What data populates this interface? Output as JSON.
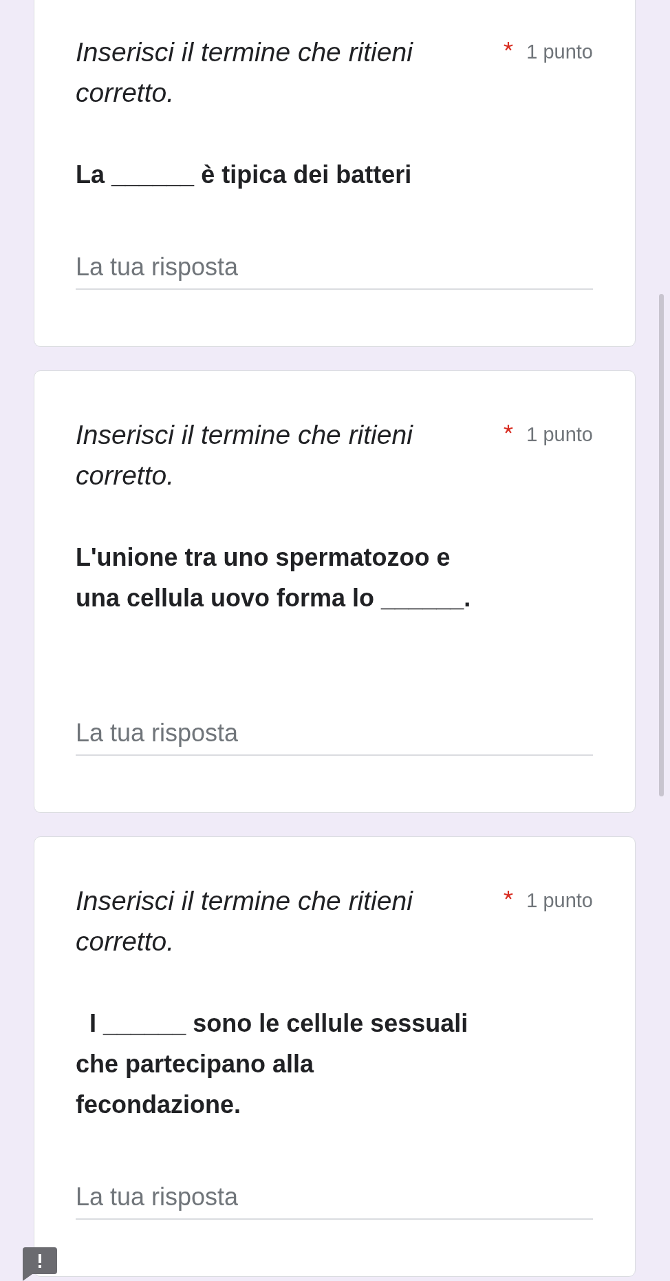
{
  "questions": [
    {
      "title": "Inserisci il termine che ritieni corretto.",
      "required": true,
      "points": "1 punto",
      "question": "La ______ è tipica dei batteri",
      "trailing_blank_line": false,
      "answer": {
        "placeholder": "La tua risposta"
      }
    },
    {
      "title": "Inserisci il termine che ritieni corretto.",
      "required": true,
      "points": "1 punto",
      "question": "L'unione tra uno spermatozoo e\nuna cellula uovo forma lo ______.",
      "trailing_blank_line": true,
      "answer": {
        "placeholder": "La tua risposta"
      }
    },
    {
      "title": "Inserisci il termine che ritieni corretto.",
      "required": true,
      "points": "1 punto",
      "question": "  I ______ sono le cellule sessuali\nche partecipano alla\nfecondazione.",
      "trailing_blank_line": false,
      "answer": {
        "placeholder": "La tua risposta"
      }
    }
  ]
}
